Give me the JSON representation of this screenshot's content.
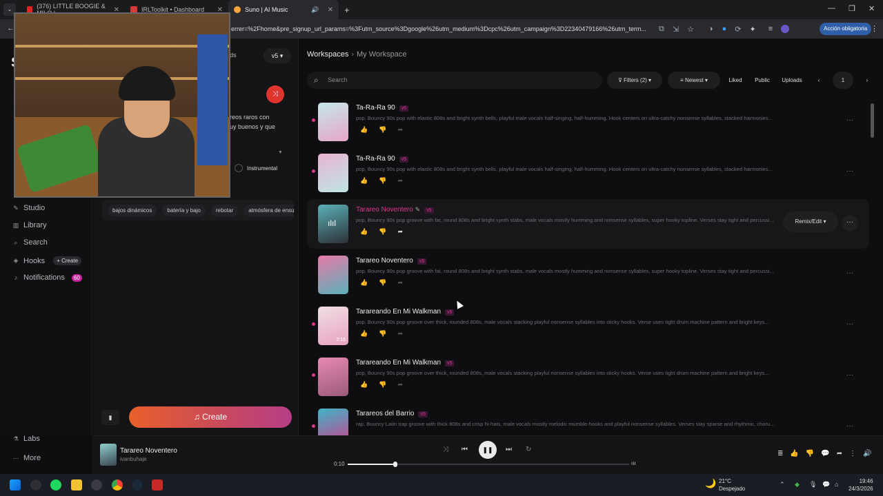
{
  "browser": {
    "tabs": [
      {
        "label": "(376) LITTLE BOOGIE & MILO |",
        "color": "#e02424"
      },
      {
        "label": "IRLToolkit • Dashboard",
        "color": "#d43a3a"
      },
      {
        "label": "Suno | AI Music",
        "color": "#f2a33a"
      }
    ],
    "url": "errer=%2Fhome&pre_signup_url_params=%3Futm_source%3Dgoogle%26utm_medium%3Dcpc%26utm_campaign%3D22340479166%26utm_term...",
    "action_button": "Acción obligatoria"
  },
  "sidebar": {
    "items": [
      {
        "label": "Studio",
        "icon": "studio-icon"
      },
      {
        "label": "Library",
        "icon": "library-icon"
      },
      {
        "label": "Search",
        "icon": "search-icon"
      },
      {
        "label": "Hooks",
        "icon": "hooks-icon"
      },
      {
        "label": "Notifications",
        "icon": "bell-icon"
      }
    ],
    "hooks_create": "+ Create",
    "notifications_count": "60",
    "bottom": [
      {
        "label": "Labs",
        "icon": "labs-icon"
      },
      {
        "label": "More",
        "icon": "more-icon"
      }
    ]
  },
  "panel": {
    "tab_fragment": "ds",
    "version": "v5",
    "lyrics_fragment_1": "reos raros con",
    "lyrics_fragment_2": "uy buenos y que",
    "instrumental": "Instrumental",
    "tags": [
      "bajos dinámicos",
      "batería y bajo",
      "rebotar",
      "atmósfera de ensue"
    ],
    "create_label": "Create"
  },
  "main": {
    "breadcrumb": {
      "root": "Workspaces",
      "current": "My Workspace"
    },
    "search_placeholder": "Search",
    "filters": "Filters (2)",
    "sort": "Newest",
    "liked": "Liked",
    "public": "Public",
    "uploads": "Uploads",
    "page": "1",
    "remix_label": "Remix/Edit",
    "songs": [
      {
        "title": "Ta-Ra-Ra 90",
        "version": "v5",
        "desc": "pop, Bouncy 90s pop with elastic 808s and bright synth bells, playful male vocals half-singing, half-humming. Hook centers on ultra-catchy nonsense syllables, stacked harmonies...",
        "duration": "",
        "thumb_a": "#c6e8e8",
        "thumb_b": "#e6a6c8"
      },
      {
        "title": "Ta-Ra-Ra 90",
        "version": "v5",
        "desc": "pop, Bouncy 90s pop with elastic 808s and bright synth bells, playful male vocals half-singing, half-humming. Hook centers on ultra-catchy nonsense syllables, stacked harmonies...",
        "duration": "",
        "thumb_a": "#e8b3d3",
        "thumb_b": "#bfe5e3"
      },
      {
        "title": "Tarareo Noventero",
        "version": "v5",
        "desc": "pop, Bouncy 90s pop groove with fat, round 808s and bright synth stabs, male vocals mostly humming and nonsense syllables, super hooky topline. Verses stay tight and percussi...",
        "duration": "",
        "thumb_a": "#5bb0b8",
        "thumb_b": "#2d3137"
      },
      {
        "title": "Tarareo Noventero",
        "version": "v5",
        "desc": "pop, Bouncy 90s pop groove with fat, round 808s and bright synth stabs, male vocals mostly humming and nonsense syllables, super hooky topline. Verses stay tight and percussi...",
        "duration": "",
        "thumb_a": "#e77aa8",
        "thumb_b": "#5bb0b8"
      },
      {
        "title": "Tarareando En Mi Walkman",
        "version": "v5",
        "desc": "pop, Bouncy 90s pop groove over thick, rounded 808s, male vocals stacking playful nonsense syllables into sticky hooks. Verse uses tight drum machine pattern and bright keys...",
        "duration": "2:16",
        "thumb_a": "#f0dfe6",
        "thumb_b": "#e8a2bf"
      },
      {
        "title": "Tarareando En Mi Walkman",
        "version": "v5",
        "desc": "pop, Bouncy 90s pop groove over thick, rounded 808s, male vocals stacking playful nonsense syllables into sticky hooks. Verse uses tight drum machine pattern and bright keys...",
        "duration": "",
        "thumb_a": "#e88ab3",
        "thumb_b": "#9a5a7a"
      },
      {
        "title": "Tarareos del Barrio",
        "version": "v5",
        "desc": "rap, Bouncy Latin trap groove with thick 808s and crisp hi-hats, male vocals mostly melodic mumble-hooks and playful nonsense syllables. Verses stay sparse and rhythmic, choru...",
        "duration": "",
        "thumb_a": "#3fb4c6",
        "thumb_b": "#d23d8c"
      }
    ]
  },
  "player": {
    "title": "Tarareo Noventero",
    "artist": "ivanbuhaje",
    "time": "0:10",
    "progress": 0.17
  },
  "taskbar": {
    "temperature": "21°C",
    "weather": "Despejado",
    "time": "19:46",
    "date": "24/3/2026"
  },
  "colors": {
    "accent": "#e0358f",
    "bg": "#0e0e10"
  }
}
